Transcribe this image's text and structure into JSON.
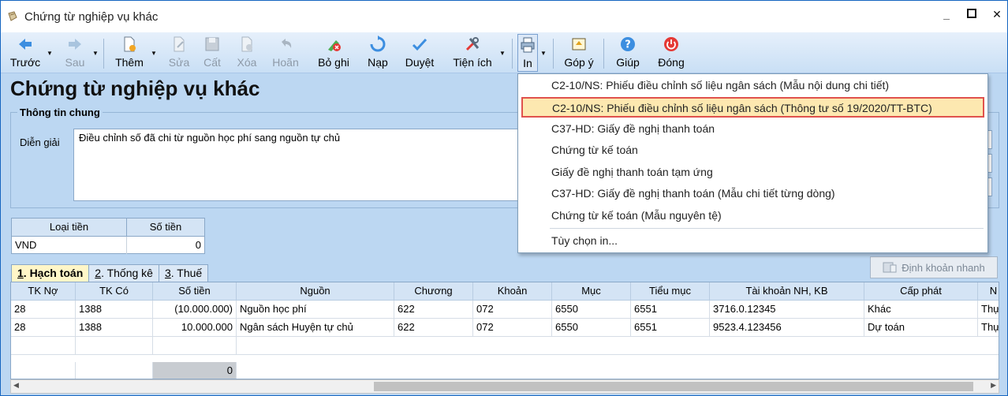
{
  "window": {
    "title": "Chứng từ nghiệp vụ khác"
  },
  "toolbar": {
    "prev": "Trước",
    "next": "Sau",
    "add": "Thêm",
    "edit": "Sửa",
    "save": "Cất",
    "delete": "Xóa",
    "undo": "Hoãn",
    "unpost": "Bỏ ghi",
    "load": "Nạp",
    "approve": "Duyệt",
    "utilities": "Tiện ích",
    "print": "In",
    "feedback": "Góp ý",
    "help": "Giúp",
    "close": "Đóng"
  },
  "page": {
    "heading": "Chứng từ nghiệp vụ khác"
  },
  "general": {
    "group_title": "Thông tin chung",
    "description_label": "Diễn giải",
    "description_value": "Điều chỉnh số đã chi từ nguồn học phí sang nguồn tự chủ"
  },
  "currency": {
    "headers": [
      "Loại tiền",
      "Số tiền"
    ],
    "row": {
      "currency": "VND",
      "amount": "0"
    }
  },
  "tabs": [
    {
      "num": "1",
      "label": ". Hạch toán",
      "active": true
    },
    {
      "num": "2",
      "label": ". Thống kê",
      "active": false
    },
    {
      "num": "3",
      "label": ". Thuế",
      "active": false
    }
  ],
  "quick_entry_button": "Định khoản nhanh",
  "grid": {
    "headers": [
      "TK Nợ",
      "TK Có",
      "Số tiền",
      "Nguồn",
      "Chương",
      "Khoản",
      "Mục",
      "Tiểu mục",
      "Tài khoản NH, KB",
      "Cấp phát",
      "N"
    ],
    "rows": [
      [
        "28",
        "1388",
        "(10.000.000)",
        "Nguồn học phí",
        "622",
        "072",
        "6550",
        "6551",
        "3716.0.12345",
        "Khác",
        "Thự"
      ],
      [
        "28",
        "1388",
        "10.000.000",
        "Ngân sách Huyện tự chủ",
        "622",
        "072",
        "6550",
        "6551",
        "9523.4.123456",
        "Dự toán",
        "Thự"
      ]
    ],
    "total": "0"
  },
  "print_menu": {
    "items": [
      "C2-10/NS: Phiếu điều chỉnh số liệu ngân sách (Mẫu nội dung chi tiết)",
      "C2-10/NS: Phiếu điều chỉnh số liệu ngân sách (Thông tư số 19/2020/TT-BTC)",
      "C37-HD: Giấy đề nghị thanh toán",
      "Chứng từ kế toán",
      "Giấy đề nghị thanh toán tạm ứng",
      "C37-HD: Giấy đề nghị thanh toán (Mẫu chi tiết từng dòng)",
      "Chứng từ kế toán (Mẫu nguyên tệ)"
    ],
    "options": "Tùy chọn in..."
  },
  "colors": {
    "highlight_border": "#e0524d",
    "highlight_fill": "#fde8b0",
    "window_background": "#bcd7f2",
    "title_border": "#1565c0"
  }
}
